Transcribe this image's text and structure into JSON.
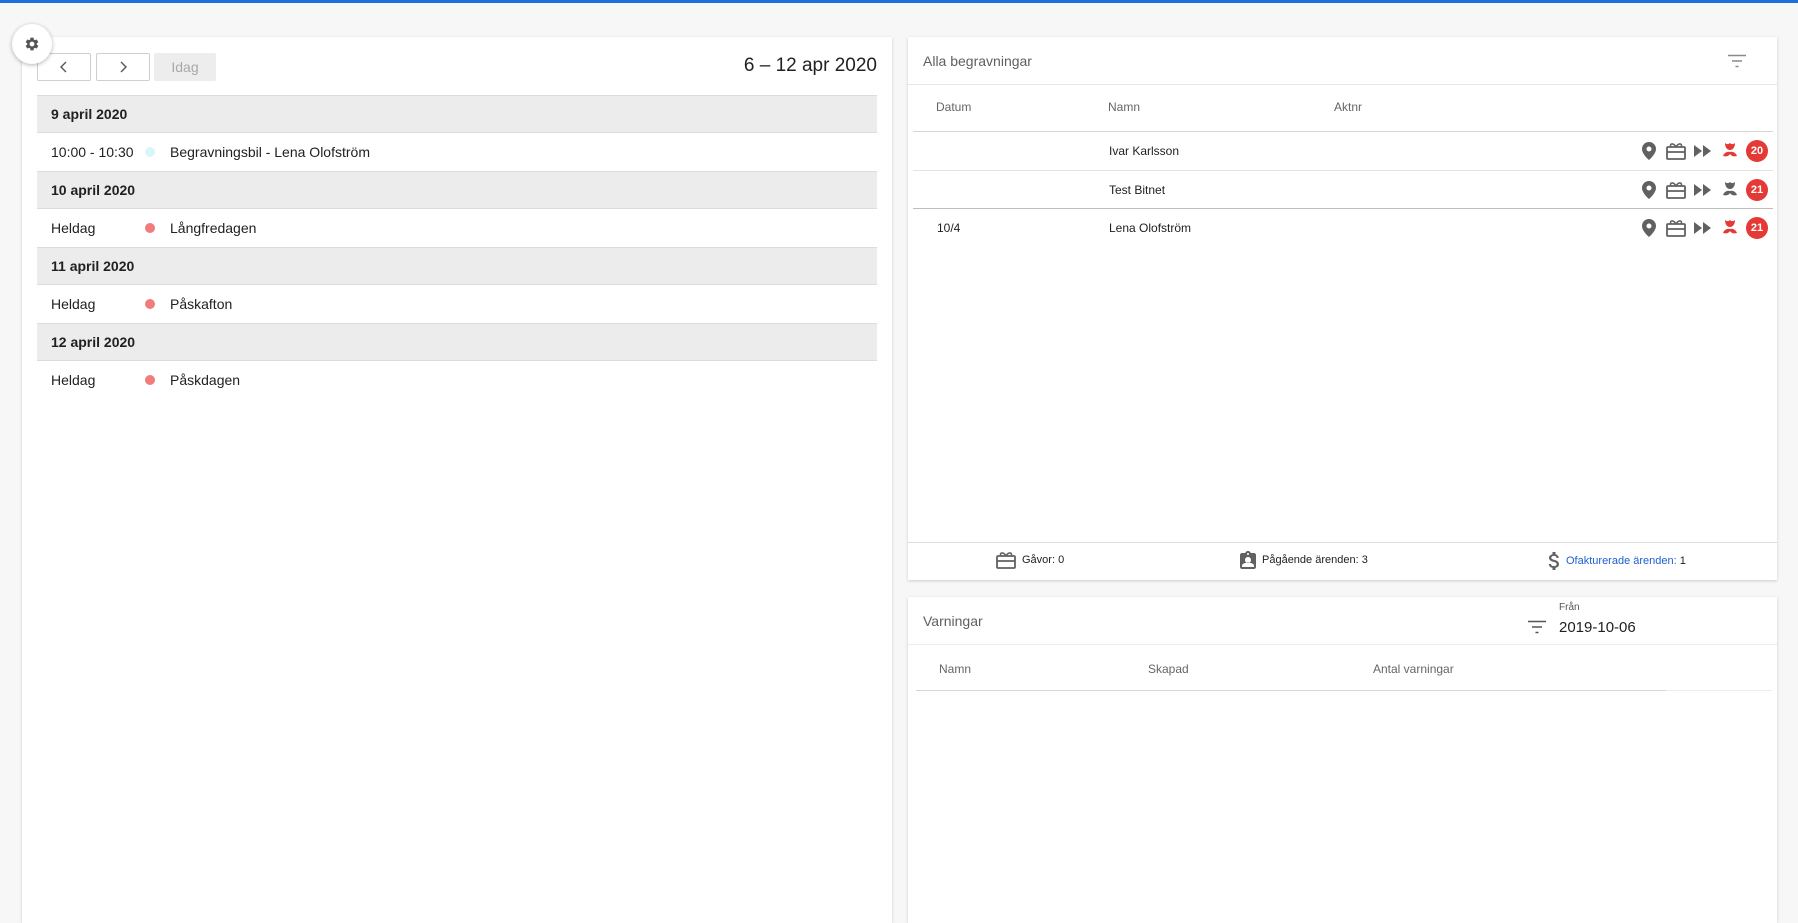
{
  "calendar": {
    "prev_icon": "chevron-left-icon",
    "next_icon": "chevron-right-icon",
    "today_label": "Idag",
    "date_range": "6 – 12 apr 2020",
    "days": [
      {
        "date": "9 april 2020",
        "events": [
          {
            "time": "10:00 - 10:30",
            "title": "Begravningsbil - Lena Olofström",
            "color": "#d9f6fb"
          }
        ]
      },
      {
        "date": "10 april 2020",
        "events": [
          {
            "time": "Heldag",
            "title": "Långfredagen",
            "color": "#f27b7b"
          }
        ]
      },
      {
        "date": "11 april 2020",
        "events": [
          {
            "time": "Heldag",
            "title": "Påskafton",
            "color": "#f27b7b"
          }
        ]
      },
      {
        "date": "12 april 2020",
        "events": [
          {
            "time": "Heldag",
            "title": "Påskdagen",
            "color": "#f27b7b"
          }
        ]
      }
    ]
  },
  "burials": {
    "title": "Alla begravningar",
    "columns": {
      "date": "Datum",
      "name": "Namn",
      "actnr": "Aktnr"
    },
    "rows": [
      {
        "date": "",
        "name": "Ivar Karlsson",
        "badge": "20",
        "flower_color": "#e53935"
      },
      {
        "date": "",
        "name": "Test Bitnet",
        "badge": "21",
        "flower_color": "#616161"
      },
      {
        "date": "10/4",
        "name": "Lena Olofström",
        "badge": "21",
        "flower_color": "#e53935"
      }
    ],
    "footer": {
      "gifts_label": "Gåvor: 0",
      "ongoing_label": "Pågående ärenden: 3",
      "uninvoiced_label": "Ofakturerade ärenden:",
      "uninvoiced_count": "1"
    }
  },
  "warnings": {
    "title": "Varningar",
    "from_label": "Från",
    "from_value": "2019-10-06",
    "columns": {
      "name": "Namn",
      "created": "Skapad",
      "count": "Antal varningar"
    }
  },
  "colors": {
    "accent": "#1e6fd9",
    "badge": "#e53935",
    "header_bg": "#ececec",
    "link": "#1e5fd1"
  }
}
